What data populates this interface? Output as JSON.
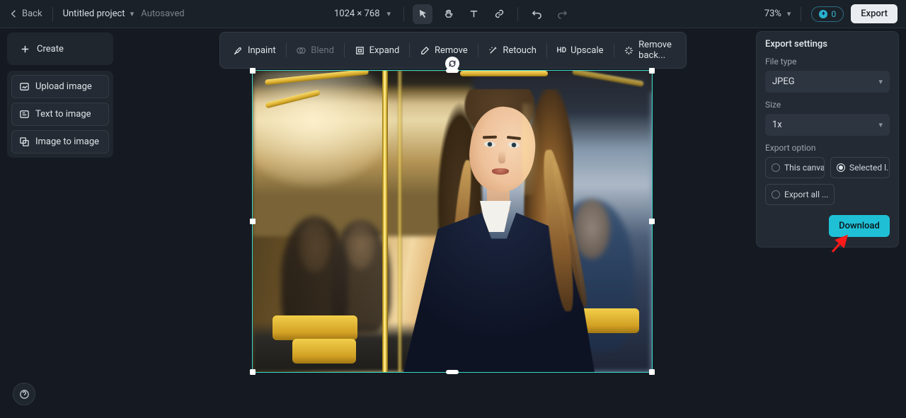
{
  "topbar": {
    "back": "Back",
    "project_name": "Untitled project",
    "autosave_status": "Autosaved",
    "canvas_dimensions": "1024 × 768",
    "zoom_percent": "73%",
    "credits_count": "0",
    "export_label": "Export"
  },
  "left_panel": {
    "create_label": "Create",
    "items": [
      {
        "label": "Upload image"
      },
      {
        "label": "Text to image"
      },
      {
        "label": "Image to image"
      }
    ]
  },
  "toolbar": {
    "inpaint": "Inpaint",
    "blend": "Blend",
    "expand": "Expand",
    "remove": "Remove",
    "retouch": "Retouch",
    "upscale_prefix": "HD",
    "upscale": "Upscale",
    "remove_back": "Remove back..."
  },
  "export_panel": {
    "title": "Export settings",
    "file_type_label": "File type",
    "file_type_value": "JPEG",
    "size_label": "Size",
    "size_value": "1x",
    "export_option_label": "Export option",
    "options": {
      "this_canvas": "This canvas",
      "selected_layer": "Selected l...",
      "export_all": "Export all ..."
    },
    "download_label": "Download",
    "selected_option": "selected_layer"
  }
}
